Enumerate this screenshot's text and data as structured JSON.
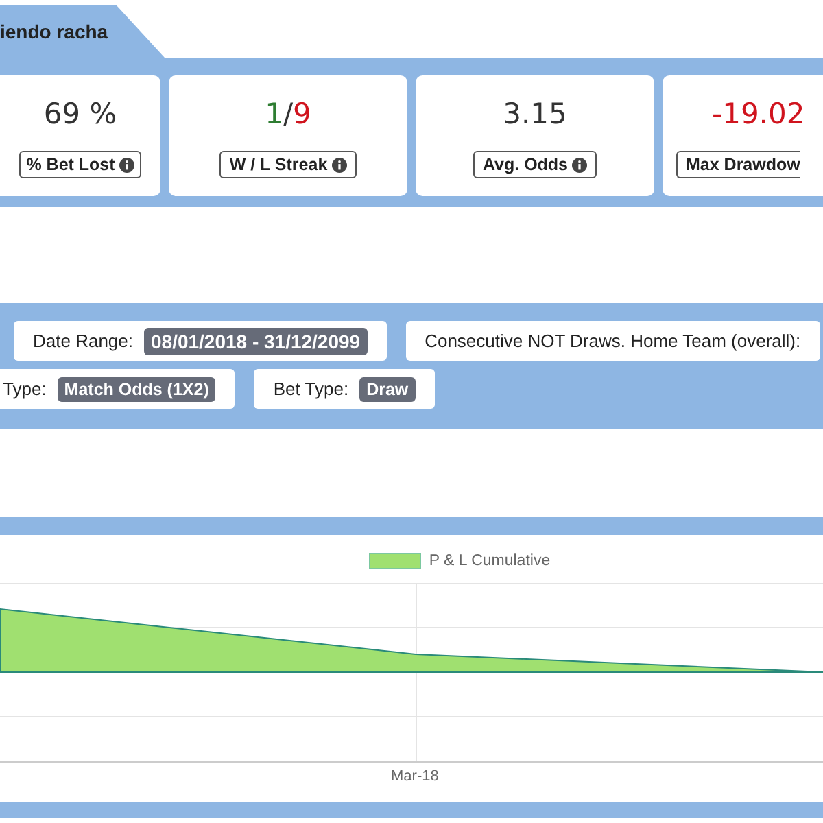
{
  "tab": {
    "label": "iendo racha"
  },
  "stats": [
    {
      "value": [
        {
          "text": "69 %",
          "color": "#333333"
        }
      ],
      "label": "% Bet Lost",
      "info": true
    },
    {
      "value": [
        {
          "text": "1",
          "color": "#2e7d32"
        },
        {
          "text": "/",
          "color": "#333333"
        },
        {
          "text": "9",
          "color": "#d0141e"
        }
      ],
      "label": "W / L Streak",
      "info": true
    },
    {
      "value": [
        {
          "text": "3.15",
          "color": "#333333"
        }
      ],
      "label": "Avg. Odds",
      "info": true
    },
    {
      "value": [
        {
          "text": "-19.02",
          "color": "#d0141e"
        }
      ],
      "label": "Max Drawdow",
      "info": false
    }
  ],
  "filters": [
    [
      {
        "label": "Date Range:",
        "badge": "08/01/2018 - 31/12/2099"
      },
      {
        "label": "Consecutive NOT Draws. Home Team (overall):"
      }
    ],
    [
      {
        "label": "Type:",
        "badge": "Match Odds (1X2)"
      },
      {
        "label": "Bet Type:",
        "badge": "Draw"
      }
    ]
  ],
  "chart": {
    "legend": [
      {
        "label": "P & L Cumulative",
        "color": "#a0e070"
      }
    ],
    "x_label": "Mar-18"
  }
}
